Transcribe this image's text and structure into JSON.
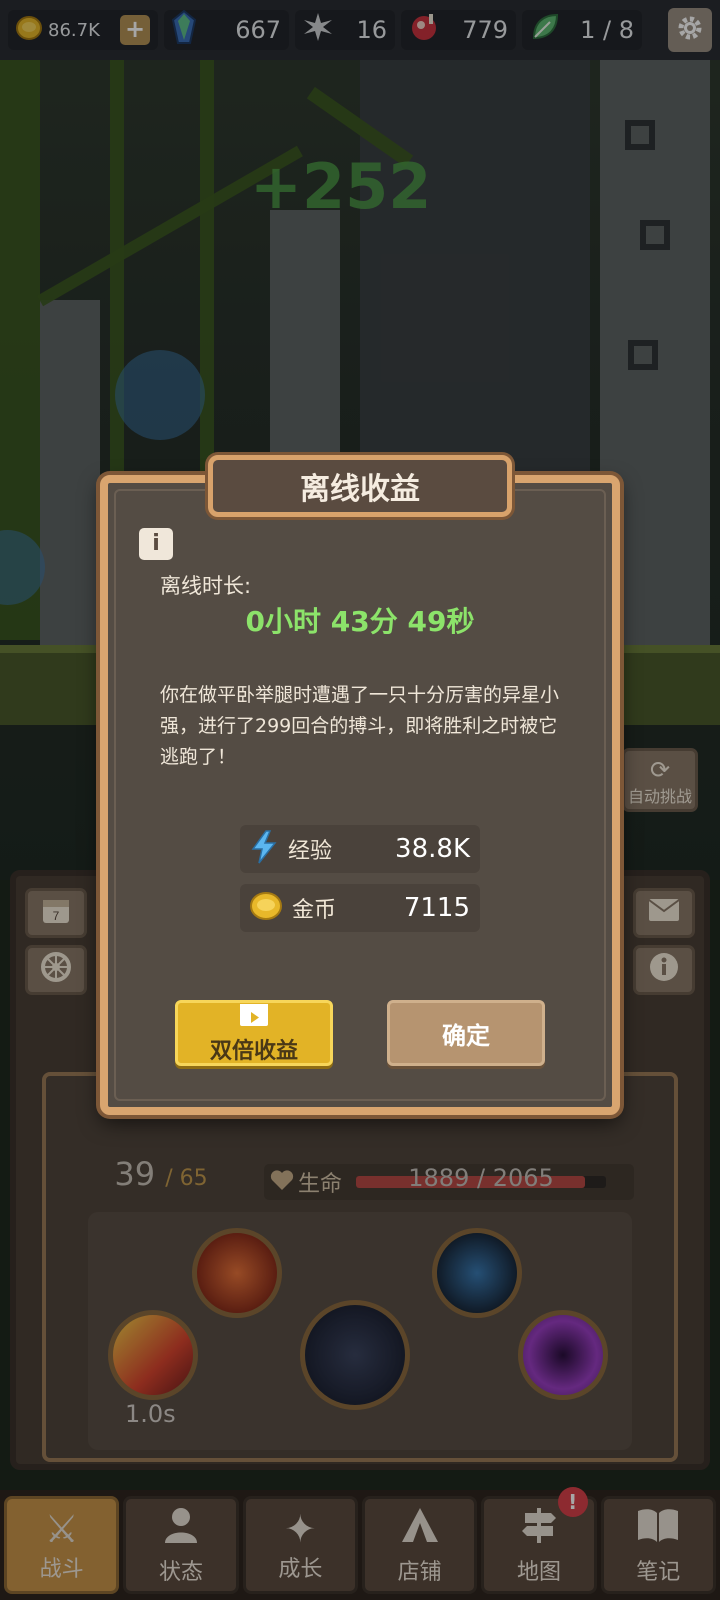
{
  "topbar": {
    "gold": "86.7K",
    "gems": "667",
    "stars": "16",
    "meat": "779",
    "leaves": "1 / 8"
  },
  "scene": {
    "damage_popup": "+252"
  },
  "modal": {
    "title": "离线收益",
    "info_icon": "i",
    "duration_label": "离线时长:",
    "duration_value": "0小时 43分 49秒",
    "story": "你在做平卧举腿时遭遇了一只十分厉害的异星小强，进行了299回合的搏斗，即将胜利之时被它逃跑了！",
    "rewards": [
      {
        "icon": "lightning-icon",
        "label": "经验",
        "value": "38.8K"
      },
      {
        "icon": "gold-coin-icon",
        "label": "金币",
        "value": "7115"
      }
    ],
    "double_button": "双倍收益",
    "confirm_button": "确定"
  },
  "panel": {
    "auto_challenge": "自动挑战",
    "level": "39",
    "level_max": "65",
    "hp_label": "生命",
    "hp_text": "1889 / 2065",
    "hp_fraction": 0.915,
    "cooldown": "1.0s"
  },
  "nav": [
    {
      "label": "战斗",
      "icon": "crossed-swords-icon",
      "active": true
    },
    {
      "label": "状态",
      "icon": "person-icon",
      "active": false
    },
    {
      "label": "成长",
      "icon": "sparkle-icon",
      "active": false
    },
    {
      "label": "店铺",
      "icon": "tent-icon",
      "active": false
    },
    {
      "label": "地图",
      "icon": "signpost-icon",
      "active": false,
      "badge": "!"
    },
    {
      "label": "笔记",
      "icon": "book-icon",
      "active": false
    }
  ],
  "colors": {
    "accent_gold": "#e2b326",
    "modal_border": "#d9a56f",
    "time_green": "#8ce36a"
  }
}
